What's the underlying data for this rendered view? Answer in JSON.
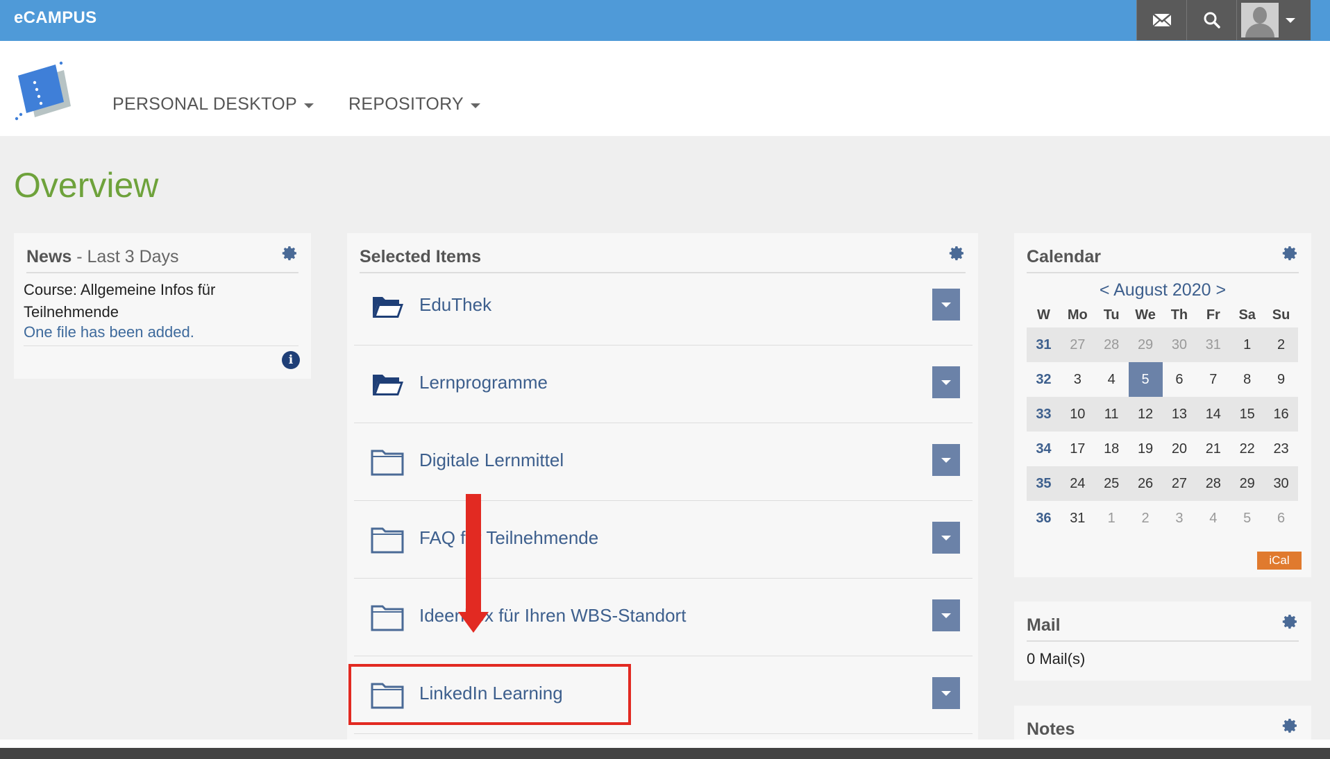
{
  "topbar": {
    "brand": "eCAMPUS",
    "colors": {
      "bar": "#4f9ad8",
      "buttons": "#5a5a5a"
    },
    "actions": [
      {
        "name": "mail-icon"
      },
      {
        "name": "search-icon"
      },
      {
        "name": "user-menu"
      }
    ]
  },
  "nav": {
    "items": [
      {
        "label": "PERSONAL DESKTOP"
      },
      {
        "label": "REPOSITORY"
      }
    ]
  },
  "page": {
    "title": "Overview",
    "title_color": "#6ea23b"
  },
  "news": {
    "title": "News",
    "subtitle": " - Last 3 Days",
    "course": "Course: Allgemeine Infos für Teilnehmende",
    "message": "One file has been added.",
    "info_icon": "i"
  },
  "selected_items": {
    "title": "Selected Items",
    "items": [
      {
        "label": "EduThek",
        "icon": "folder-open-icon"
      },
      {
        "label": "Lernprogramme",
        "icon": "folder-open-icon"
      },
      {
        "label": "Digitale Lernmittel",
        "icon": "folder-icon"
      },
      {
        "label": "FAQ für Teilnehmende",
        "icon": "folder-icon"
      },
      {
        "label": "Ideenbox für Ihren WBS-Standort",
        "icon": "folder-icon"
      },
      {
        "label": "LinkedIn Learning",
        "icon": "folder-icon"
      }
    ]
  },
  "calendar": {
    "title": "Calendar",
    "prev": "<",
    "month": "August 2020",
    "next": ">",
    "headers": [
      "W",
      "Mo",
      "Tu",
      "We",
      "Th",
      "Fr",
      "Sa",
      "Su"
    ],
    "weeks": [
      {
        "w": "31",
        "days": [
          "27",
          "28",
          "29",
          "30",
          "31",
          "1",
          "2"
        ]
      },
      {
        "w": "32",
        "days": [
          "3",
          "4",
          "5",
          "6",
          "7",
          "8",
          "9"
        ]
      },
      {
        "w": "33",
        "days": [
          "10",
          "11",
          "12",
          "13",
          "14",
          "15",
          "16"
        ]
      },
      {
        "w": "34",
        "days": [
          "17",
          "18",
          "19",
          "20",
          "21",
          "22",
          "23"
        ]
      },
      {
        "w": "35",
        "days": [
          "24",
          "25",
          "26",
          "27",
          "28",
          "29",
          "30"
        ]
      },
      {
        "w": "36",
        "days": [
          "31",
          "1",
          "2",
          "3",
          "4",
          "5",
          "6"
        ]
      }
    ],
    "today": "5",
    "ical_label": "iCal",
    "today_color": "#6b82a8",
    "ical_color": "#e07a2e"
  },
  "mail": {
    "title": "Mail",
    "count": "0 Mail(s)"
  },
  "notes": {
    "title": "Notes"
  },
  "annotation": {
    "color": "#e22a22"
  }
}
